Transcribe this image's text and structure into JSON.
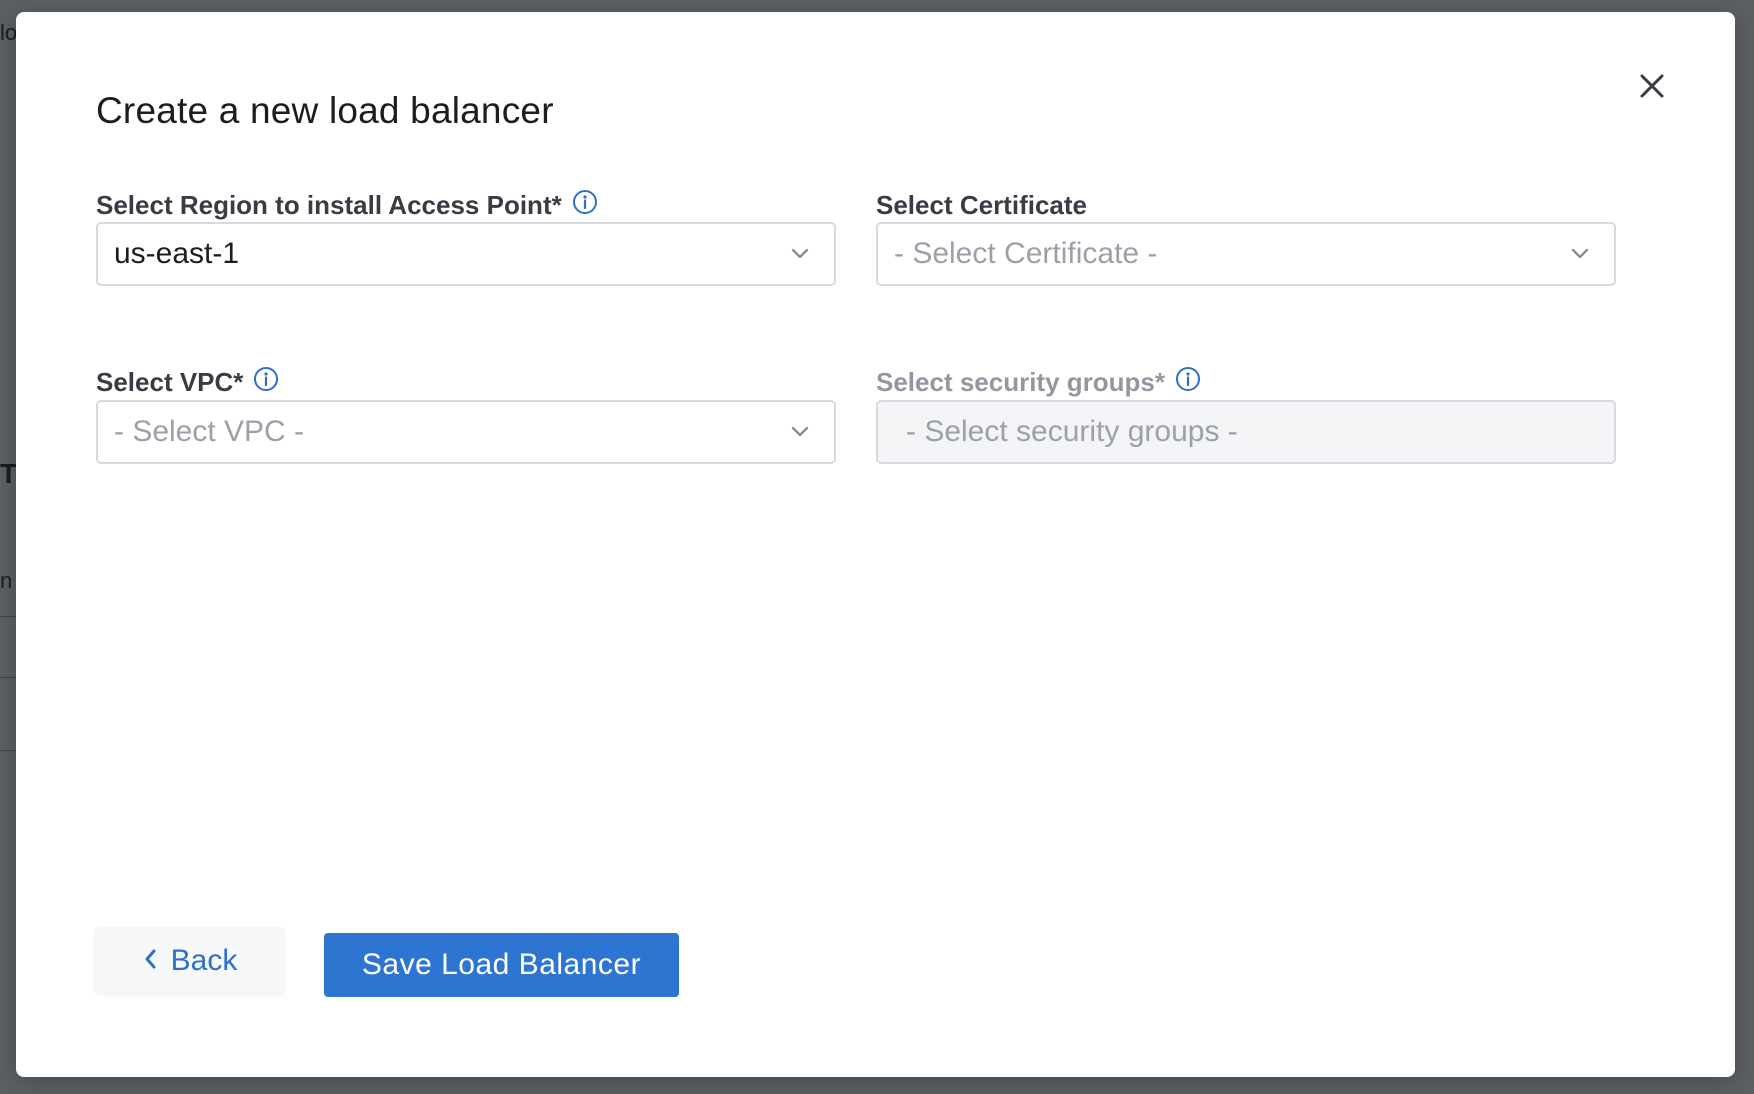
{
  "background": {
    "fragments": [
      "lo",
      "T",
      "n l"
    ]
  },
  "modal": {
    "title": "Create a new load balancer",
    "close_icon": "close-icon",
    "fields": {
      "region": {
        "label": "Select Region to install Access Point*",
        "value": "us-east-1",
        "has_info": true
      },
      "certificate": {
        "label": "Select Certificate",
        "placeholder": "- Select Certificate -",
        "has_info": false
      },
      "vpc": {
        "label": "Select VPC*",
        "placeholder": "- Select VPC -",
        "has_info": true
      },
      "security_groups": {
        "label": "Select security groups*",
        "placeholder": "- Select security groups -",
        "has_info": true,
        "disabled": true
      }
    },
    "buttons": {
      "back_label": "Back",
      "save_label": "Save Load Balancer"
    }
  },
  "colors": {
    "accent": "#2e74d1",
    "info_icon": "#2f6fc9",
    "overlay": "#5c6064"
  }
}
